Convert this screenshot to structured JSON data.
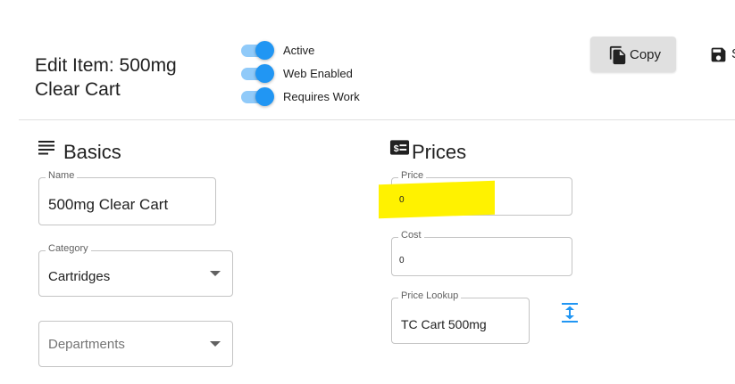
{
  "header": {
    "title": "Edit Item: 500mg Clear Cart",
    "toggles": [
      {
        "label": "Active",
        "on": true
      },
      {
        "label": "Web Enabled",
        "on": true
      },
      {
        "label": "Requires Work",
        "on": true
      }
    ],
    "copy_label": "Copy",
    "save_label": "S"
  },
  "basics": {
    "heading": "Basics",
    "icon": "notes-icon",
    "name_field": {
      "label": "Name",
      "value": "500mg Clear Cart"
    },
    "category_field": {
      "label": "Category",
      "value": "Cartridges"
    },
    "departments_field": {
      "placeholder": "Departments"
    }
  },
  "prices": {
    "heading": "Prices",
    "icon": "price-tag-icon",
    "price_field": {
      "label": "Price",
      "value": "0"
    },
    "cost_field": {
      "label": "Cost",
      "value": "0"
    },
    "lookup_field": {
      "label": "Price Lookup",
      "value": "TC Cart 500mg"
    }
  },
  "colors": {
    "accent": "#2196f3",
    "accent_light": "#90caf9",
    "highlight": "#fff200",
    "button_bg": "#e0e0e0"
  }
}
